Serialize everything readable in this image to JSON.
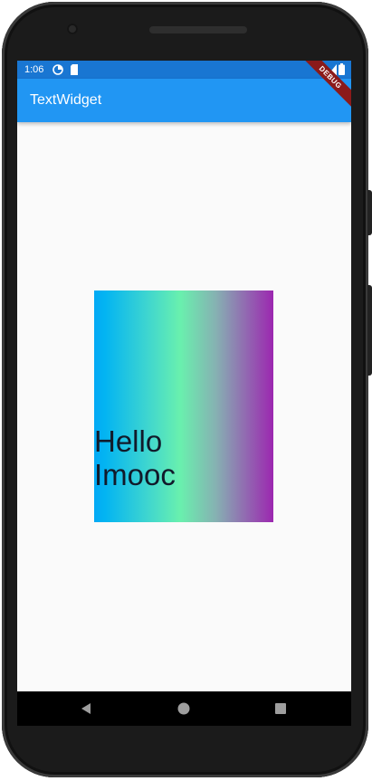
{
  "status_bar": {
    "time": "1:06",
    "icons": [
      "data-saver-icon",
      "sd-card-icon",
      "signal-icon",
      "battery-icon"
    ]
  },
  "app_bar": {
    "title": "TextWidget"
  },
  "debug_banner": {
    "label": "DEBUG"
  },
  "gradient_box": {
    "text": "Hello\nImooc",
    "gradient_colors": [
      "#03a9f4",
      "#69f0ae",
      "#9c27b0"
    ]
  },
  "nav_bar": {
    "buttons": [
      "back-icon",
      "home-icon",
      "recents-icon"
    ]
  },
  "colors": {
    "status_bar": "#1976d2",
    "app_bar": "#2196f3",
    "background": "#fafafa"
  }
}
